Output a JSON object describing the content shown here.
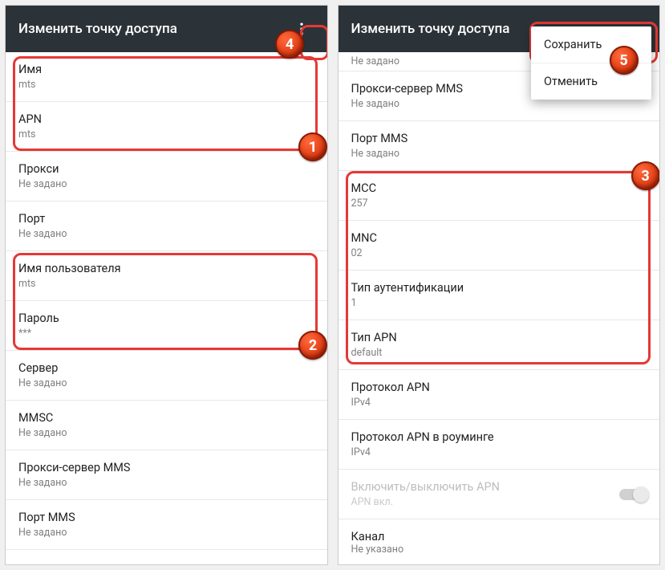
{
  "left": {
    "title": "Изменить точку доступа",
    "rows": [
      {
        "label": "Имя",
        "value": "mts"
      },
      {
        "label": "APN",
        "value": "mts"
      },
      {
        "label": "Прокси",
        "value": "Не задано"
      },
      {
        "label": "Порт",
        "value": "Не задано"
      },
      {
        "label": "Имя пользователя",
        "value": "mts"
      },
      {
        "label": "Пароль",
        "value": "***"
      },
      {
        "label": "Сервер",
        "value": "Не задано"
      },
      {
        "label": "MMSC",
        "value": "Не задано"
      },
      {
        "label": "Прокси-сервер MMS",
        "value": "Не задано"
      },
      {
        "label": "Порт MMS",
        "value": "Не задано"
      }
    ]
  },
  "right": {
    "title": "Изменить точку доступа",
    "cut_value": "Не задано",
    "rows": [
      {
        "label": "Прокси-сервер MMS",
        "value": "Не задано"
      },
      {
        "label": "Порт MMS",
        "value": "Не задано"
      },
      {
        "label": "MCC",
        "value": "257"
      },
      {
        "label": "MNC",
        "value": "02"
      },
      {
        "label": "Тип аутентификации",
        "value": "1"
      },
      {
        "label": "Тип APN",
        "value": "default"
      },
      {
        "label": "Протокол APN",
        "value": "IPv4"
      },
      {
        "label": "Протокол APN в роуминге",
        "value": "IPv4"
      },
      {
        "label": "Включить/выключить APN",
        "value": "APN вкл.",
        "disabled": true,
        "toggle": true
      },
      {
        "label": "Канал",
        "value": "Не указано"
      }
    ],
    "popup": {
      "save": "Сохранить",
      "cancel": "Отменить"
    }
  },
  "badges": {
    "1": "1",
    "2": "2",
    "3": "3",
    "4": "4",
    "5": "5"
  }
}
